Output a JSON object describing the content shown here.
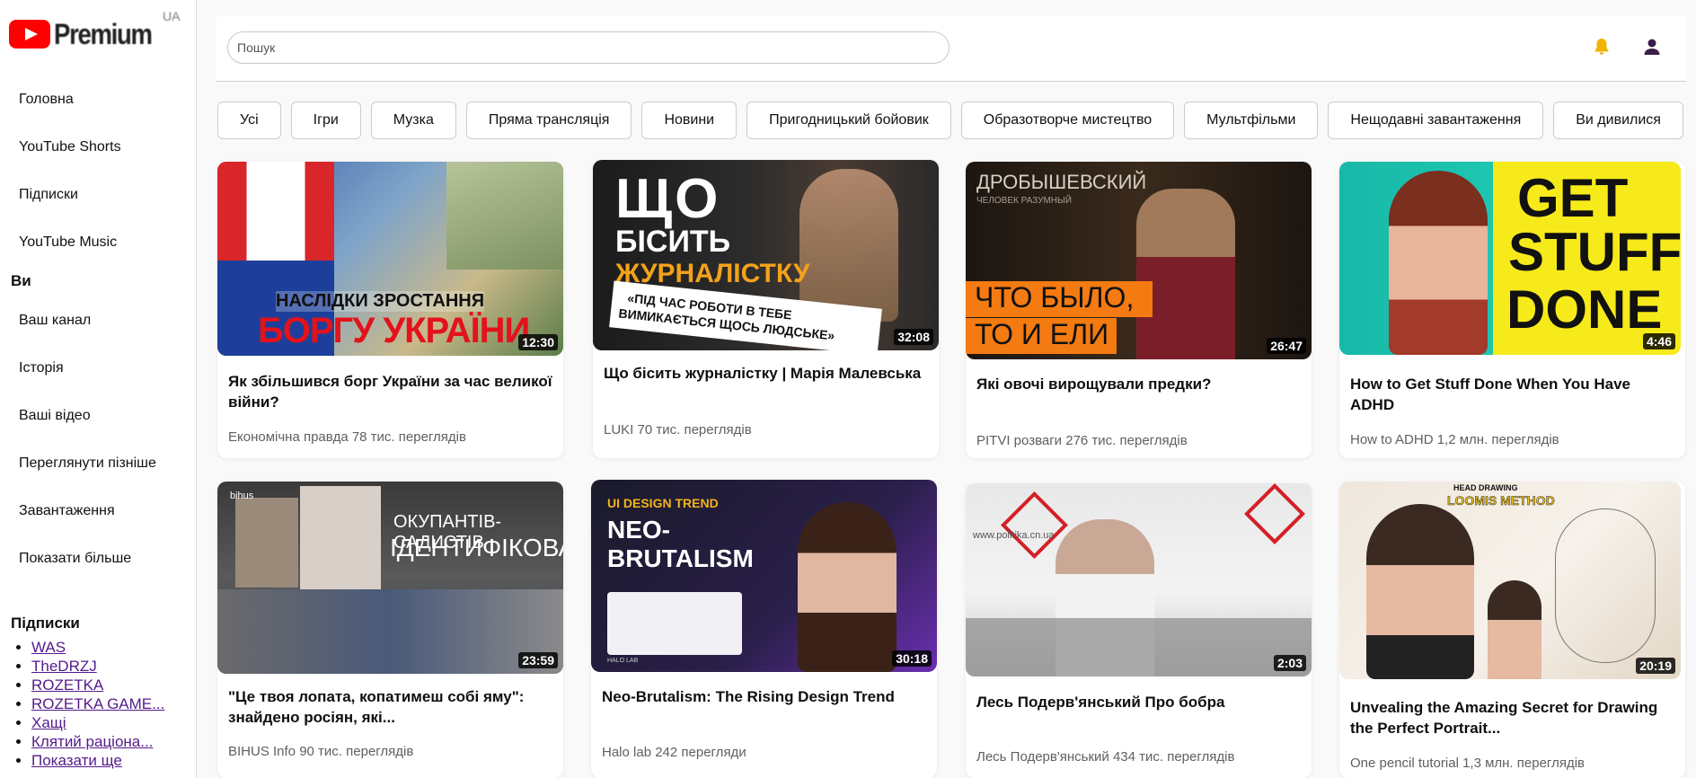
{
  "logo": {
    "text": "Premium",
    "region": "UA"
  },
  "search": {
    "placeholder": "Пошук"
  },
  "sidebar": {
    "nav": [
      "Головна",
      "YouTube Shorts",
      "Підписки",
      "YouTube Music"
    ],
    "you_title": "Ви",
    "you_items": [
      "Ваш канал",
      "Історія",
      "Ваші відео",
      "Переглянути пізніше",
      "Завантаження",
      "Показати більше"
    ],
    "subs_title": "Підписки",
    "subs": [
      "WAS",
      "TheDRZJ",
      "ROZETKA",
      "ROZETKA GAME...",
      "Хащі",
      "Клятий раціона...",
      "Показати ще"
    ]
  },
  "chips": [
    "Усі",
    "Ігри",
    "Музка",
    "Пряма трансляція",
    "Новини",
    "Пригодницький бойовик",
    "Образотворче мистецтво",
    "Мультфільми",
    "Нещодавні завантаження",
    "Ви дивилися"
  ],
  "videos": [
    {
      "title": "Як збільшився борг України за час великої війни?",
      "meta": "Економічна правда 78 тис. переглядів",
      "duration": "12:30",
      "thumb_text": [
        "НАСЛІДКИ ЗРОСТАННЯ",
        "БОРГУ УКРАЇНИ"
      ]
    },
    {
      "title": "Що бісить журналістку | Марія Малевська",
      "meta": "LUKI 70 тис. переглядів",
      "duration": "32:08",
      "thumb_text": [
        "ЩО",
        "БІСИТЬ",
        "ЖУРНАЛІСТКУ",
        "«ПІД ЧАС РОБОТИ В ТЕБЕ",
        "ВИМИКАЄТЬСЯ ЩОСЬ ЛЮДСЬКЕ»"
      ]
    },
    {
      "title": "Які овочі вирощували предки?",
      "meta": "PITVI розваги 276 тис. переглядів",
      "duration": "26:47",
      "thumb_text": [
        "ДРОБЫШЕВСКИЙ",
        "ЧЕЛОВЕК РАЗУМНЫЙ",
        "ЧТО БЫЛО,",
        "ТО И ЕЛИ"
      ]
    },
    {
      "title": "How to Get Stuff Done When You Have ADHD",
      "meta": "How to ADHD 1,2 млн. переглядів",
      "duration": "4:46",
      "thumb_text": [
        "GET",
        "STUFF",
        "DONE"
      ]
    },
    {
      "title": "\"Це твоя лопата, копатимеш собі яму\": знайдено росіян, які...",
      "meta": "BIHUS Info 90 тис. переглядів",
      "duration": "23:59",
      "thumb_text": [
        "bihus",
        "ОКУПАНТІВ-САДИСТІВ",
        "ІДЕНТИФІКОВАНО"
      ]
    },
    {
      "title": "Neo-Brutalism: The Rising Design Trend",
      "meta": "Halo lab 242 перегляди",
      "duration": "30:18",
      "thumb_text": [
        "UI DESIGN TREND",
        "NEO-",
        "BRUTALISM",
        "HALO LAB"
      ]
    },
    {
      "title": "Лесь Подерв'янський Про бобра",
      "meta": "Лесь Подерв'янський 434 тис. переглядів",
      "duration": "2:03",
      "thumb_text": [
        "www.politika.cn.ua"
      ]
    },
    {
      "title": "Unvealing the Amazing Secret for Drawing the Perfect Portrait...",
      "meta": "One pencil tutorial 1,3 млн. переглядів",
      "duration": "20:19",
      "thumb_text": [
        "HEAD DRAWING",
        "LOOMIS METHOD"
      ]
    }
  ],
  "colors": {
    "accent_red": "#ff0000",
    "bell": "#f2b400",
    "profile": "#3b1d4a",
    "link": "#551a8b"
  }
}
